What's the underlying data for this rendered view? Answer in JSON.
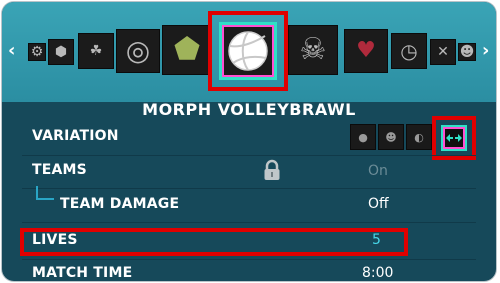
{
  "game_mode": {
    "title": "MORPH VOLLEYBRAWL"
  },
  "carousel": {
    "left_arrow": "‹",
    "right_arrow": "›",
    "tiles": [
      {
        "icon": "gear-tile-icon",
        "glyph": "⚙"
      },
      {
        "icon": "shield-tile-icon",
        "glyph": "⬢"
      },
      {
        "icon": "creature-tile-icon",
        "glyph": "☘"
      },
      {
        "icon": "target-tile-icon",
        "glyph": "◎"
      },
      {
        "icon": "d20-tile-icon",
        "glyph": "⬟"
      },
      {
        "icon": "volleyball-tile-icon",
        "glyph": "●"
      },
      {
        "icon": "skull-tile-icon",
        "glyph": "☠"
      },
      {
        "icon": "heart-tile-icon",
        "glyph": "♥"
      },
      {
        "icon": "clock-tile-icon",
        "glyph": "◷"
      },
      {
        "icon": "swords-tile-icon",
        "glyph": "✕"
      },
      {
        "icon": "cat-tile-icon",
        "glyph": "☻"
      }
    ],
    "selected_index": 5
  },
  "settings": {
    "variation": {
      "label": "VARIATION",
      "selected_icon": "arrows-icon"
    },
    "teams": {
      "label": "TEAMS",
      "value": "On",
      "locked": true
    },
    "team_damage": {
      "label": "TEAM DAMAGE",
      "value": "Off"
    },
    "lives": {
      "label": "LIVES",
      "value": "5"
    },
    "match_time": {
      "label": "MATCH TIME",
      "value": "8:00"
    }
  },
  "colors": {
    "highlight_red": "#e00000",
    "selection_teal": "#2fe0c6",
    "selection_pink": "#ff4fd0",
    "accent_cyan": "#46d6e8",
    "header_teal": "#2b8ea2",
    "panel_dark": "#16495a"
  }
}
